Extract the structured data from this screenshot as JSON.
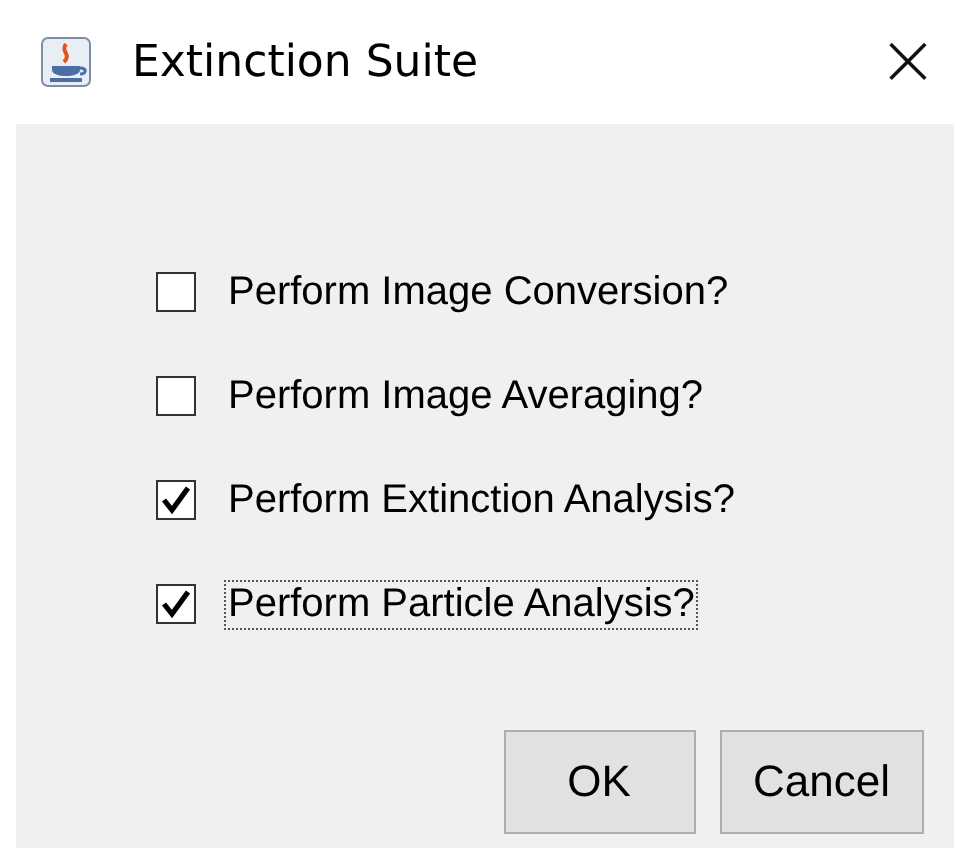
{
  "window": {
    "title": "Extinction Suite",
    "close": "×"
  },
  "options": [
    {
      "label": "Perform Image Conversion?",
      "checked": false,
      "focused": false
    },
    {
      "label": "Perform Image Averaging?",
      "checked": false,
      "focused": false
    },
    {
      "label": "Perform Extinction Analysis?",
      "checked": true,
      "focused": false
    },
    {
      "label": "Perform Particle Analysis?",
      "checked": true,
      "focused": true
    }
  ],
  "buttons": [
    "OK",
    "Cancel"
  ]
}
